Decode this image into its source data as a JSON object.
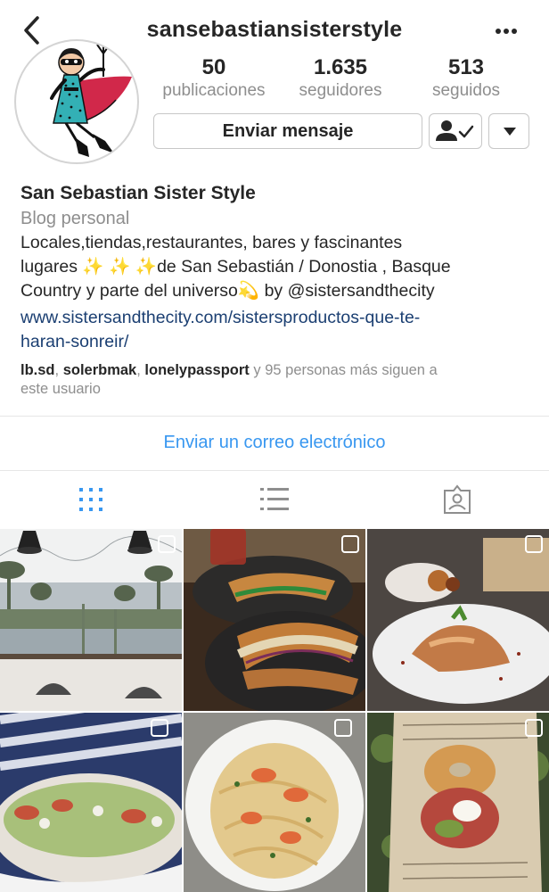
{
  "header": {
    "username": "sansebastiansisterstyle"
  },
  "stats": [
    {
      "value": "50",
      "label": "publicaciones"
    },
    {
      "value": "1.635",
      "label": "seguidores"
    },
    {
      "value": "513",
      "label": "seguidos"
    }
  ],
  "actions": {
    "message_label": "Enviar mensaje"
  },
  "bio": {
    "name": "San Sebastian Sister Style",
    "category": "Blog personal",
    "line1": "Locales,tiendas,restaurantes, bares y fascinantes",
    "line2_pre": "lugares ",
    "sparkles": "✨ ✨ ✨",
    "line2_post": "de San Sebastián / Donostia , Basque",
    "line3_pre": "Country y parte del universo",
    "comet": "💫",
    "line3_post": " by @sistersandthecity",
    "link_line1": "www.sistersandthecity.com/sistersproductos-que-te-",
    "link_line2": "haran-sonreir/",
    "followed_by": [
      "lb.sd",
      "solerbmak",
      "lonelypassport"
    ],
    "followed_sep": ", ",
    "followed_rest": " y 95 personas más siguen a",
    "followed_rest2": "este usuario"
  },
  "email_label": "Enviar un correo electrónico",
  "tabs": [
    {
      "icon": "grid-icon",
      "active": true
    },
    {
      "icon": "list-icon",
      "active": false
    },
    {
      "icon": "tagged-icon",
      "active": false
    }
  ],
  "posts": [
    {
      "subject": "cafe-window"
    },
    {
      "subject": "sandwich"
    },
    {
      "subject": "octopus-dish"
    },
    {
      "subject": "salad-bowl"
    },
    {
      "subject": "pasta-prawns"
    },
    {
      "subject": "bagel-newspaper"
    }
  ],
  "colors": {
    "link": "#1b3f72",
    "accent_blue": "#3897f0",
    "secondary_text": "#8e8e8e"
  }
}
